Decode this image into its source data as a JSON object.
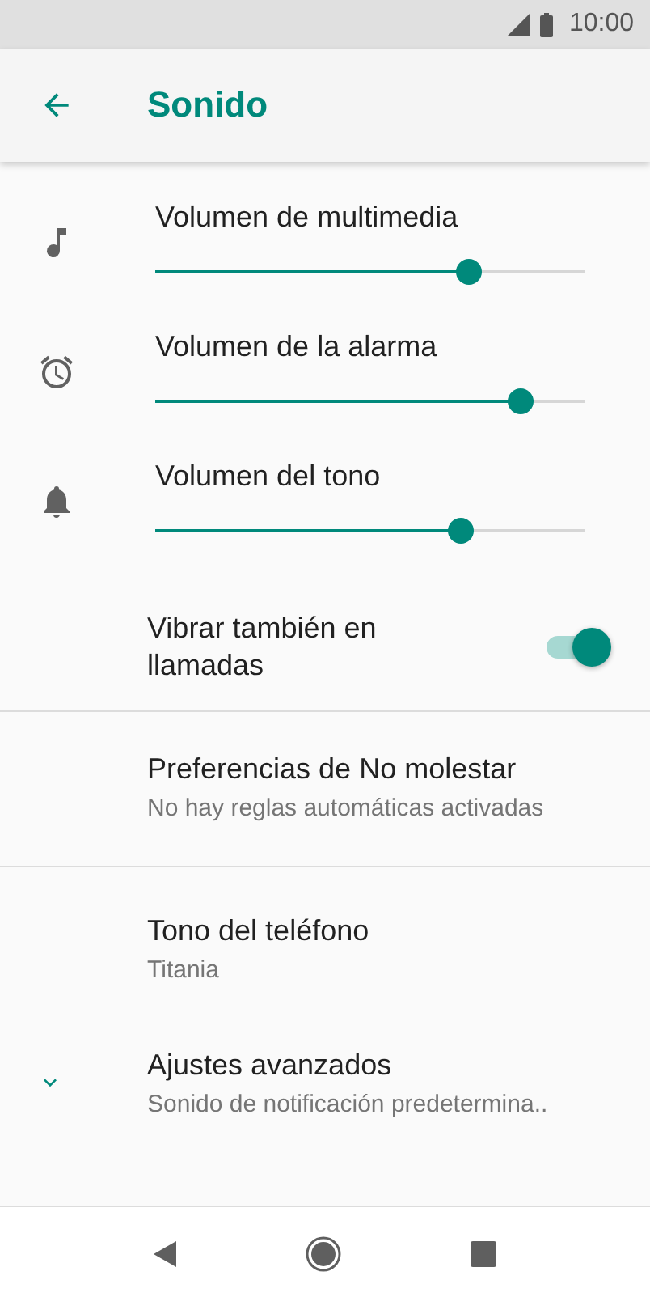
{
  "status_bar": {
    "time": "10:00"
  },
  "app_bar": {
    "title": "Sonido"
  },
  "volumes": [
    {
      "label": "Volumen de multimedia",
      "level": 0.73
    },
    {
      "label": "Volumen de la alarma",
      "level": 0.85
    },
    {
      "label": "Volumen del tono",
      "level": 0.71
    }
  ],
  "vibrate": {
    "label": "Vibrar también en llamadas",
    "on": true
  },
  "dnd": {
    "title": "Preferencias de No molestar",
    "subtitle": "No hay reglas automáticas activadas"
  },
  "ringtone": {
    "title": "Tono del teléfono",
    "subtitle": "Titania"
  },
  "advanced": {
    "title": "Ajustes avanzados",
    "subtitle": "Sonido de notificación predetermina..",
    "expanded": false
  }
}
